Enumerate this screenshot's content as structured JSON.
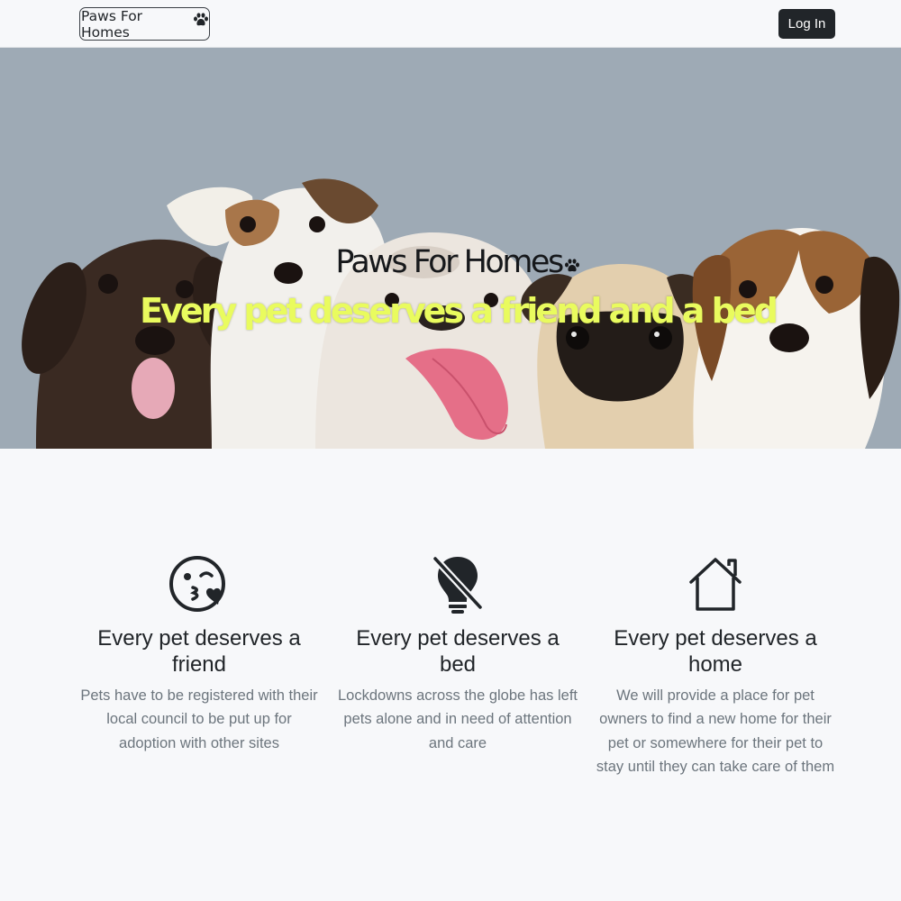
{
  "navbar": {
    "brand": "Paws For Homes",
    "brand_icon": "paw-icon",
    "login_label": "Log In"
  },
  "hero": {
    "title": "Paws For Homes",
    "title_icon": "paw-icon",
    "tagline": "Every pet deserves a friend and a bed",
    "image": "puppies-photo"
  },
  "features": [
    {
      "icon": "kiss-wink-heart-icon",
      "heading": "Every pet deserves a friend",
      "text": "Pets have to be registered with their local council to be put up for adoption with other sites"
    },
    {
      "icon": "lightbulb-off-icon",
      "heading": "Every pet deserves a bed",
      "text": "Lockdowns across the globe has left pets alone and in need of attention and care"
    },
    {
      "icon": "house-icon",
      "heading": "Every pet deserves a home",
      "text": "We will provide a place for pet owners to find a new home for their pet or somewhere for their pet to stay until they can take care of them"
    }
  ],
  "colors": {
    "tagline": "#e9fb5e",
    "button": "#212529",
    "hero_bg": "#9eaab5"
  }
}
